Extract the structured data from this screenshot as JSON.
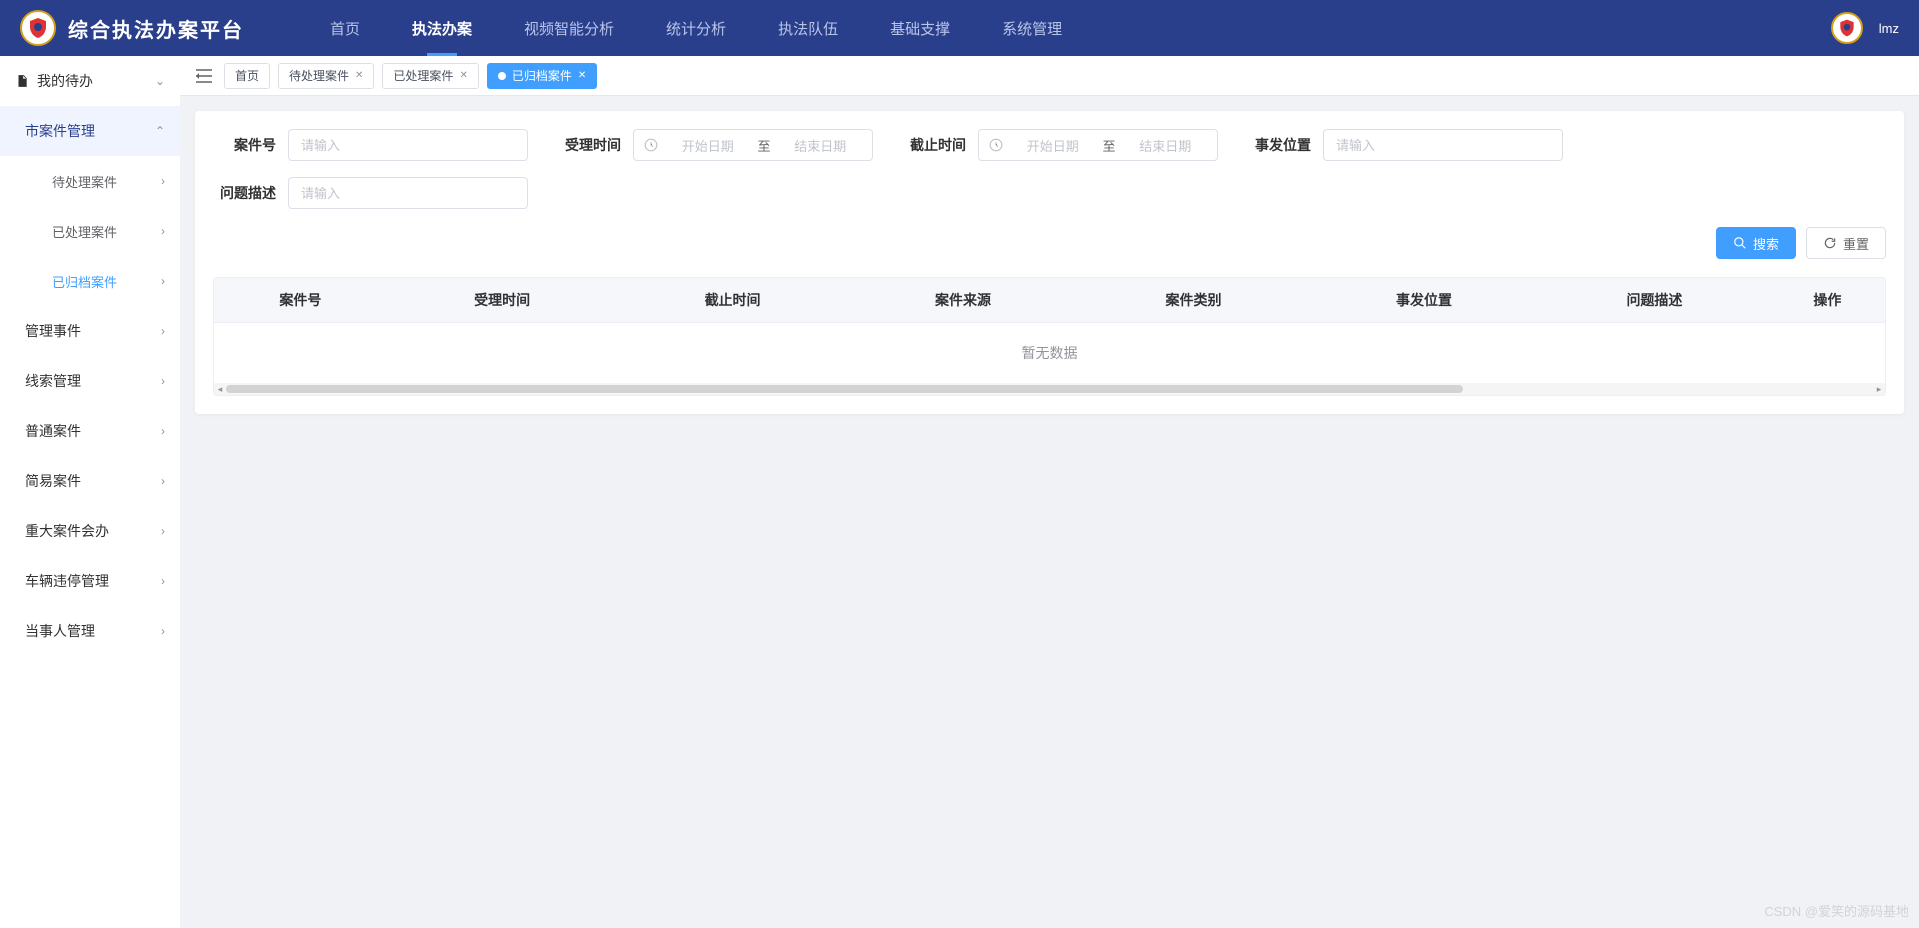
{
  "header": {
    "app_title": "综合执法办案平台",
    "nav": [
      {
        "label": "首页",
        "active": false
      },
      {
        "label": "执法办案",
        "active": true
      },
      {
        "label": "视频智能分析",
        "active": false
      },
      {
        "label": "统计分析",
        "active": false
      },
      {
        "label": "执法队伍",
        "active": false
      },
      {
        "label": "基础支撑",
        "active": false
      },
      {
        "label": "系统管理",
        "active": false
      }
    ],
    "user": "lmz"
  },
  "sidebar": {
    "items": [
      {
        "label": "我的待办",
        "level": 0,
        "expanded": false,
        "icon": "doc"
      },
      {
        "label": "市案件管理",
        "level": 1,
        "expanded": true
      },
      {
        "label": "待处理案件",
        "level": 2
      },
      {
        "label": "已处理案件",
        "level": 2
      },
      {
        "label": "已归档案件",
        "level": 2,
        "active": true
      },
      {
        "label": "管理事件",
        "level": 1
      },
      {
        "label": "线索管理",
        "level": 1
      },
      {
        "label": "普通案件",
        "level": 1
      },
      {
        "label": "简易案件",
        "level": 1
      },
      {
        "label": "重大案件会办",
        "level": 1
      },
      {
        "label": "车辆违停管理",
        "level": 1
      },
      {
        "label": "当事人管理",
        "level": 1
      }
    ]
  },
  "tabs": [
    {
      "label": "首页",
      "closable": false,
      "active": false
    },
    {
      "label": "待处理案件",
      "closable": true,
      "active": false
    },
    {
      "label": "已处理案件",
      "closable": true,
      "active": false
    },
    {
      "label": "已归档案件",
      "closable": true,
      "active": true
    }
  ],
  "search": {
    "case_no_label": "案件号",
    "case_no_placeholder": "请输入",
    "accept_time_label": "受理时间",
    "deadline_label": "截止时间",
    "date_start_ph": "开始日期",
    "date_sep": "至",
    "date_end_ph": "结束日期",
    "location_label": "事发位置",
    "location_placeholder": "请输入",
    "desc_label": "问题描述",
    "desc_placeholder": "请输入",
    "search_btn": "搜索",
    "reset_btn": "重置"
  },
  "table": {
    "columns": [
      "案件号",
      "受理时间",
      "截止时间",
      "案件来源",
      "案件类别",
      "事发位置",
      "问题描述",
      "操作"
    ],
    "empty": "暂无数据"
  },
  "watermark": "CSDN @爱笑的源码基地"
}
